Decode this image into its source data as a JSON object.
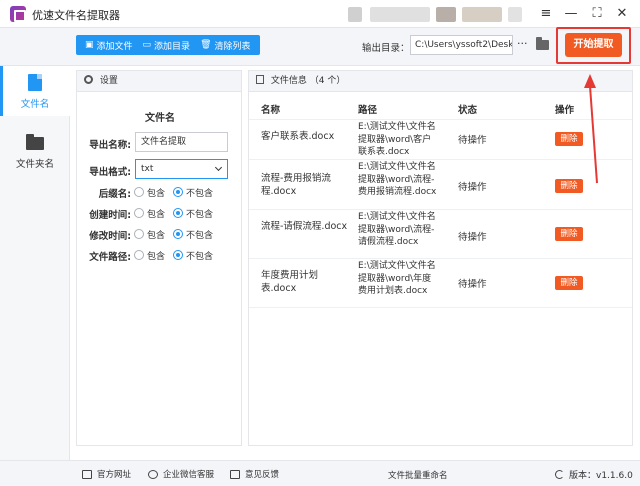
{
  "window": {
    "title": "优速文件名提取器",
    "controls": [
      "menu-icon",
      "minimize-icon",
      "maximize-icon",
      "close-icon"
    ]
  },
  "toolbar": {
    "add_file": "添加文件",
    "add_dir": "添加目录",
    "clear_list": "清除列表",
    "output_label": "输出目录：",
    "output_path": "C:\\Users\\yssoft2\\Deskt",
    "more": "···",
    "start": "开始提取"
  },
  "sidenav": {
    "items": [
      {
        "label": "文件名",
        "icon": "file-icon",
        "active": true
      },
      {
        "label": "文件夹名",
        "icon": "folder-icon",
        "active": false
      }
    ]
  },
  "settings": {
    "header": "设置",
    "title": "文件名",
    "export_name_label": "导出名称:",
    "export_name_value": "文件名提取",
    "export_format_label": "导出格式:",
    "export_format_value": "txt",
    "options": [
      {
        "label": "后缀名:",
        "include": "包含",
        "exclude": "不包含",
        "selected": "exclude"
      },
      {
        "label": "创建时间:",
        "include": "包含",
        "exclude": "不包含",
        "selected": "exclude"
      },
      {
        "label": "修改时间:",
        "include": "包含",
        "exclude": "不包含",
        "selected": "exclude"
      },
      {
        "label": "文件路径:",
        "include": "包含",
        "exclude": "不包含",
        "selected": "exclude"
      }
    ]
  },
  "filelist": {
    "header": "文件信息 （4 个）",
    "columns": [
      "名称",
      "路径",
      "状态",
      "操作"
    ],
    "rows": [
      {
        "name": "客户联系表.docx",
        "path": "E:\\测试文件\\文件名提取器\\word\\客户联系表.docx",
        "status": "待操作",
        "action": "删除"
      },
      {
        "name": "流程-费用报销流程.docx",
        "path": "E:\\测试文件\\文件名提取器\\word\\流程-费用报销流程.docx",
        "status": "待操作",
        "action": "删除"
      },
      {
        "name": "流程-请假流程.docx",
        "path": "E:\\测试文件\\文件名提取器\\word\\流程-请假流程.docx",
        "status": "待操作",
        "action": "删除"
      },
      {
        "name": "年度费用计划表.docx",
        "path": "E:\\测试文件\\文件名提取器\\word\\年度费用计划表.docx",
        "status": "待操作",
        "action": "删除"
      }
    ]
  },
  "statusbar": {
    "website": "官方网址",
    "wechat": "企业微信客服",
    "feedback": "意见反馈",
    "center": "文件批量重命名",
    "version": "版本：v1.1.6.0"
  },
  "colors": {
    "accent": "#2196f3",
    "start": "#f15a22",
    "highlight": "#e53935"
  }
}
